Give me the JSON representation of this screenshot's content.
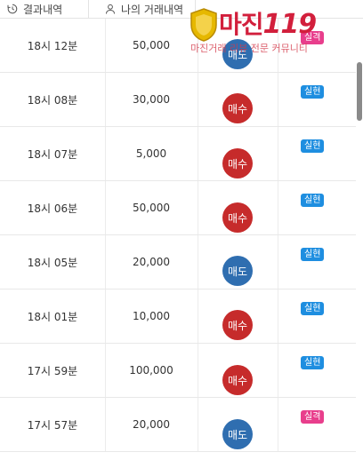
{
  "tabs": [
    {
      "label": "결과내역",
      "icon": "history-icon"
    },
    {
      "label": "나의 거래내역",
      "icon": "user-icon"
    }
  ],
  "watermark": {
    "brand": "마진",
    "brand_num": "119",
    "tagline": "마진거래 리뷰 전문 커뮤니티"
  },
  "rows": [
    {
      "time": "18시 12분",
      "amount": "50,000",
      "action": "매도",
      "result": "실격"
    },
    {
      "time": "18시 08분",
      "amount": "30,000",
      "action": "매수",
      "result": "실현"
    },
    {
      "time": "18시 07분",
      "amount": "5,000",
      "action": "매수",
      "result": "실현"
    },
    {
      "time": "18시 06분",
      "amount": "50,000",
      "action": "매수",
      "result": "실현"
    },
    {
      "time": "18시 05분",
      "amount": "20,000",
      "action": "매도",
      "result": "실현"
    },
    {
      "time": "18시 01분",
      "amount": "10,000",
      "action": "매수",
      "result": "실현"
    },
    {
      "time": "17시 59분",
      "amount": "100,000",
      "action": "매수",
      "result": "실현"
    },
    {
      "time": "17시 57분",
      "amount": "20,000",
      "action": "매도",
      "result": "실격"
    }
  ],
  "colors": {
    "buy": "#c62b2b",
    "sell": "#2f6eb0",
    "realized": "#1e8ee0",
    "failed": "#e83e8c"
  }
}
